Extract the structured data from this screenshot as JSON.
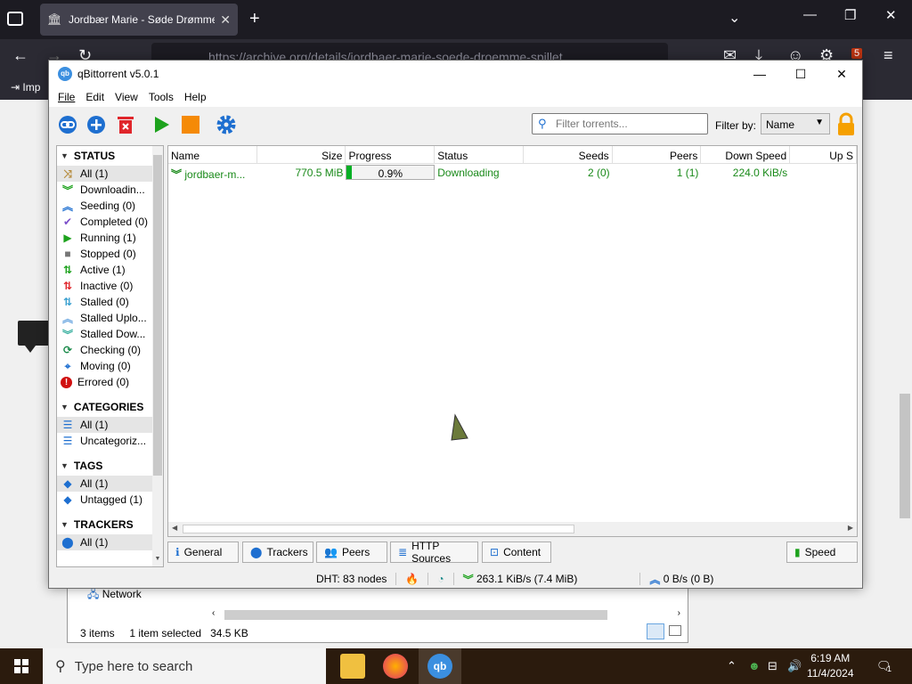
{
  "browser": {
    "tab_title": "Jordbær Marie - Søde Drømme",
    "url": "https://archive.org/details/jordbaer-marie-soede-droemme-spillet",
    "bookmark_label": "Imp",
    "extension_badge": "5"
  },
  "explorer": {
    "network_label": "Network",
    "item_count": "3 items",
    "selection": "1 item selected",
    "size": "34.5 KB"
  },
  "qbit": {
    "title": "qBittorrent v5.0.1",
    "menu": [
      "File",
      "Edit",
      "View",
      "Tools",
      "Help"
    ],
    "filter_placeholder": "Filter torrents...",
    "filter_by_label": "Filter by:",
    "filter_by_value": "Name",
    "sidebar": {
      "status_header": "STATUS",
      "status_items": [
        {
          "label": "All (1)",
          "icon": "shuffle-icon"
        },
        {
          "label": "Downloadin...",
          "icon": "download-icon"
        },
        {
          "label": "Seeding (0)",
          "icon": "upload-icon"
        },
        {
          "label": "Completed (0)",
          "icon": "check-icon"
        },
        {
          "label": "Running (1)",
          "icon": "play-icon"
        },
        {
          "label": "Stopped (0)",
          "icon": "stop-icon"
        },
        {
          "label": "Active (1)",
          "icon": "active-icon"
        },
        {
          "label": "Inactive (0)",
          "icon": "inactive-icon"
        },
        {
          "label": "Stalled (0)",
          "icon": "stalled-icon"
        },
        {
          "label": "Stalled Uplo...",
          "icon": "stalled-upload-icon"
        },
        {
          "label": "Stalled Dow...",
          "icon": "stalled-download-icon"
        },
        {
          "label": "Checking (0)",
          "icon": "checking-icon"
        },
        {
          "label": "Moving (0)",
          "icon": "moving-icon"
        },
        {
          "label": "Errored (0)",
          "icon": "error-icon"
        }
      ],
      "categories_header": "CATEGORIES",
      "categories": [
        "All (1)",
        "Uncategoriz..."
      ],
      "tags_header": "TAGS",
      "tags": [
        "All (1)",
        "Untagged (1)"
      ],
      "trackers_header": "TRACKERS",
      "trackers": [
        "All (1)"
      ]
    },
    "columns": [
      "Name",
      "Size",
      "Progress",
      "Status",
      "Seeds",
      "Peers",
      "Down Speed",
      "Up S"
    ],
    "torrents": [
      {
        "name": "jordbaer-m...",
        "size": "770.5 MiB",
        "progress": "0.9%",
        "progress_value": 0.009,
        "status": "Downloading",
        "seeds": "2 (0)",
        "peers": "1 (1)",
        "down_speed": "224.0 KiB/s"
      }
    ],
    "tabs": [
      "General",
      "Trackers",
      "Peers",
      "HTTP Sources",
      "Content"
    ],
    "speed_tab": "Speed",
    "status_bar": {
      "dht": "DHT: 83 nodes",
      "download": "263.1 KiB/s (7.4 MiB)",
      "upload": "0 B/s (0 B)"
    }
  },
  "taskbar": {
    "search_placeholder": "Type here to search",
    "time": "6:19 AM",
    "date": "11/4/2024",
    "notification_count": "1"
  },
  "colors": {
    "accent_blue": "#1e6fd0",
    "download_green": "#1a8a1a",
    "delete_red": "#e0262b",
    "stop_orange": "#f58a07"
  }
}
